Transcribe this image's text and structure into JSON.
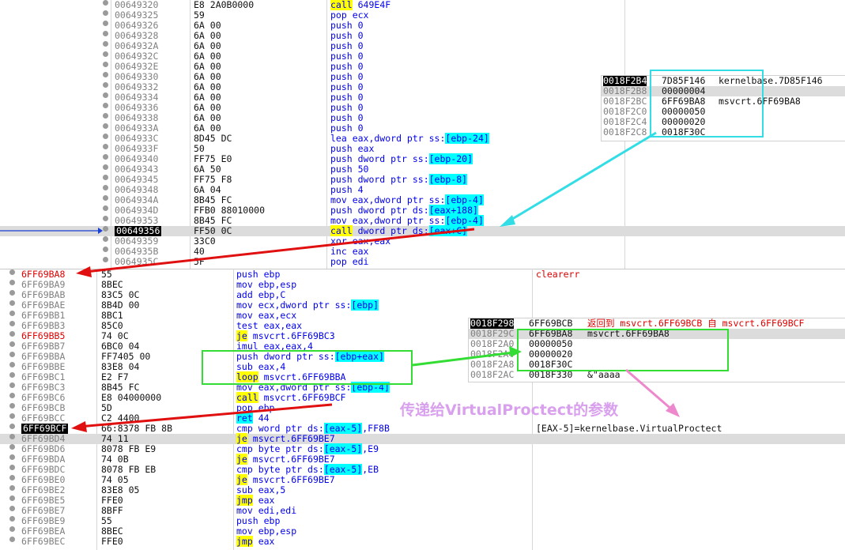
{
  "top_rows": [
    {
      "addr": "00649320",
      "bytes": "E8 2A0B0000",
      "instr": "call 649E4F"
    },
    {
      "addr": "00649325",
      "bytes": "59",
      "instr": "pop ecx"
    },
    {
      "addr": "00649326",
      "bytes": "6A 00",
      "instr": "push 0"
    },
    {
      "addr": "00649328",
      "bytes": "6A 00",
      "instr": "push 0"
    },
    {
      "addr": "0064932A",
      "bytes": "6A 00",
      "instr": "push 0"
    },
    {
      "addr": "0064932C",
      "bytes": "6A 00",
      "instr": "push 0"
    },
    {
      "addr": "0064932E",
      "bytes": "6A 00",
      "instr": "push 0"
    },
    {
      "addr": "00649330",
      "bytes": "6A 00",
      "instr": "push 0"
    },
    {
      "addr": "00649332",
      "bytes": "6A 00",
      "instr": "push 0"
    },
    {
      "addr": "00649334",
      "bytes": "6A 00",
      "instr": "push 0"
    },
    {
      "addr": "00649336",
      "bytes": "6A 00",
      "instr": "push 0"
    },
    {
      "addr": "00649338",
      "bytes": "6A 00",
      "instr": "push 0"
    },
    {
      "addr": "0064933A",
      "bytes": "6A 00",
      "instr": "push 0"
    },
    {
      "addr": "0064933C",
      "bytes": "8D45 DC",
      "instr": "lea eax,dword ptr ss:[ebp-24]"
    },
    {
      "addr": "0064933F",
      "bytes": "50",
      "instr": "push eax"
    },
    {
      "addr": "00649340",
      "bytes": "FF75 E0",
      "instr": "push dword ptr ss:[ebp-20]"
    },
    {
      "addr": "00649343",
      "bytes": "6A 50",
      "instr": "push 50"
    },
    {
      "addr": "00649345",
      "bytes": "FF75 F8",
      "instr": "push dword ptr ss:[ebp-8]"
    },
    {
      "addr": "00649348",
      "bytes": "6A 04",
      "instr": "push 4"
    },
    {
      "addr": "0064934A",
      "bytes": "8B45 FC",
      "instr": "mov eax,dword ptr ss:[ebp-4]"
    },
    {
      "addr": "0064934D",
      "bytes": "FFB0 88010000",
      "instr": "push dword ptr ds:[eax+188]"
    },
    {
      "addr": "00649353",
      "bytes": "8B45 FC",
      "instr": "mov eax,dword ptr ss:[ebp-4]"
    },
    {
      "addr": "00649356",
      "bytes": "FF50 0C",
      "instr": "call dword ptr ds:[eax+C]"
    },
    {
      "addr": "00649359",
      "bytes": "33C0",
      "instr": "xor eax,eax"
    },
    {
      "addr": "0064935B",
      "bytes": "40",
      "instr": "inc eax"
    },
    {
      "addr": "0064935C",
      "bytes": "5F",
      "instr": "pop edi"
    }
  ],
  "bottom_rows": [
    {
      "addr": "6FF69BA8",
      "bytes": "55",
      "instr": "push ebp",
      "comment": "clearerr"
    },
    {
      "addr": "6FF69BA9",
      "bytes": "8BEC",
      "instr": "mov ebp,esp",
      "comment": ""
    },
    {
      "addr": "6FF69BAB",
      "bytes": "83C5 0C",
      "instr": "add ebp,C",
      "comment": ""
    },
    {
      "addr": "6FF69BAE",
      "bytes": "8B4D 00",
      "instr": "mov ecx,dword ptr ss:[ebp]",
      "comment": ""
    },
    {
      "addr": "6FF69BB1",
      "bytes": "8BC1",
      "instr": "mov eax,ecx",
      "comment": ""
    },
    {
      "addr": "6FF69BB3",
      "bytes": "85C0",
      "instr": "test eax,eax",
      "comment": ""
    },
    {
      "addr": "6FF69BB5",
      "bytes": "74 0C",
      "instr": "je msvcrt.6FF69BC3",
      "comment": ""
    },
    {
      "addr": "6FF69BB7",
      "bytes": "6BC0 04",
      "instr": "imul eax,eax,4",
      "comment": ""
    },
    {
      "addr": "6FF69BBA",
      "bytes": "FF7405 00",
      "instr": "push dword ptr ss:[ebp+eax]",
      "comment": ""
    },
    {
      "addr": "6FF69BBE",
      "bytes": "83E8 04",
      "instr": "sub eax,4",
      "comment": ""
    },
    {
      "addr": "6FF69BC1",
      "bytes": "E2 F7",
      "instr": "loop msvcrt.6FF69BBA",
      "comment": ""
    },
    {
      "addr": "6FF69BC3",
      "bytes": "8B45 FC",
      "instr": "mov eax,dword ptr ss:[ebp-4]",
      "comment": ""
    },
    {
      "addr": "6FF69BC6",
      "bytes": "E8 04000000",
      "instr": "call msvcrt.6FF69BCF",
      "comment": ""
    },
    {
      "addr": "6FF69BCB",
      "bytes": "5D",
      "instr": "pop ebp",
      "comment": ""
    },
    {
      "addr": "6FF69BCC",
      "bytes": "C2 4400",
      "instr": "ret 44",
      "comment": ""
    },
    {
      "addr": "6FF69BCF",
      "bytes": "66:8378 FB 8B",
      "instr": "cmp word ptr ds:[eax-5],FF8B",
      "comment": "[EAX-5]=kernelbase.VirtualProctect"
    },
    {
      "addr": "6FF69BD4",
      "bytes": "74 11",
      "instr": "je msvcrt.6FF69BE7",
      "comment": ""
    },
    {
      "addr": "6FF69BD6",
      "bytes": "8078 FB E9",
      "instr": "cmp byte ptr ds:[eax-5],E9",
      "comment": ""
    },
    {
      "addr": "6FF69BDA",
      "bytes": "74 0B",
      "instr": "je msvcrt.6FF69BE7",
      "comment": ""
    },
    {
      "addr": "6FF69BDC",
      "bytes": "8078 FB EB",
      "instr": "cmp byte ptr ds:[eax-5],EB",
      "comment": ""
    },
    {
      "addr": "6FF69BE0",
      "bytes": "74 05",
      "instr": "je msvcrt.6FF69BE7",
      "comment": ""
    },
    {
      "addr": "6FF69BE2",
      "bytes": "83E8 05",
      "instr": "sub eax,5",
      "comment": ""
    },
    {
      "addr": "6FF69BE5",
      "bytes": "FFE0",
      "instr": "jmp eax",
      "comment": ""
    },
    {
      "addr": "6FF69BE7",
      "bytes": "8BFF",
      "instr": "mov edi,edi",
      "comment": ""
    },
    {
      "addr": "6FF69BE9",
      "bytes": "55",
      "instr": "push ebp",
      "comment": ""
    },
    {
      "addr": "6FF69BEA",
      "bytes": "8BEC",
      "instr": "mov ebp,esp",
      "comment": ""
    },
    {
      "addr": "6FF69BEC",
      "bytes": "FFE0",
      "instr": "jmp eax",
      "comment": ""
    }
  ],
  "stack1": [
    {
      "addr": "0018F2B4",
      "val": "7D85F146",
      "cmt": "kernelbase.7D85F146"
    },
    {
      "addr": "0018F2B8",
      "val": "00000004",
      "cmt": ""
    },
    {
      "addr": "0018F2BC",
      "val": "6FF69BA8",
      "cmt": "msvcrt.6FF69BA8"
    },
    {
      "addr": "0018F2C0",
      "val": "00000050",
      "cmt": ""
    },
    {
      "addr": "0018F2C4",
      "val": "00000020",
      "cmt": ""
    },
    {
      "addr": "0018F2C8",
      "val": "0018F30C",
      "cmt": ""
    }
  ],
  "stack2": [
    {
      "addr": "0018F298",
      "val": "6FF69BCB",
      "cmt": "返回到 msvcrt.6FF69BCB 自 msvcrt.6FF69BCF"
    },
    {
      "addr": "0018F29C",
      "val": "6FF69BA8",
      "cmt": "msvcrt.6FF69BA8"
    },
    {
      "addr": "0018F2A0",
      "val": "00000050",
      "cmt": ""
    },
    {
      "addr": "0018F2A4",
      "val": "00000020",
      "cmt": ""
    },
    {
      "addr": "0018F2A8",
      "val": "0018F30C",
      "cmt": ""
    },
    {
      "addr": "0018F2AC",
      "val": "0018F330",
      "cmt": "&\"aaaa"
    }
  ],
  "annotation": "传递给VirtualProctect的参数",
  "colors": {
    "cyan": "#33dde6",
    "red": "#e01010",
    "green": "#33dd33",
    "pink": "#ee88cc",
    "blue": "#1a3fd4"
  }
}
